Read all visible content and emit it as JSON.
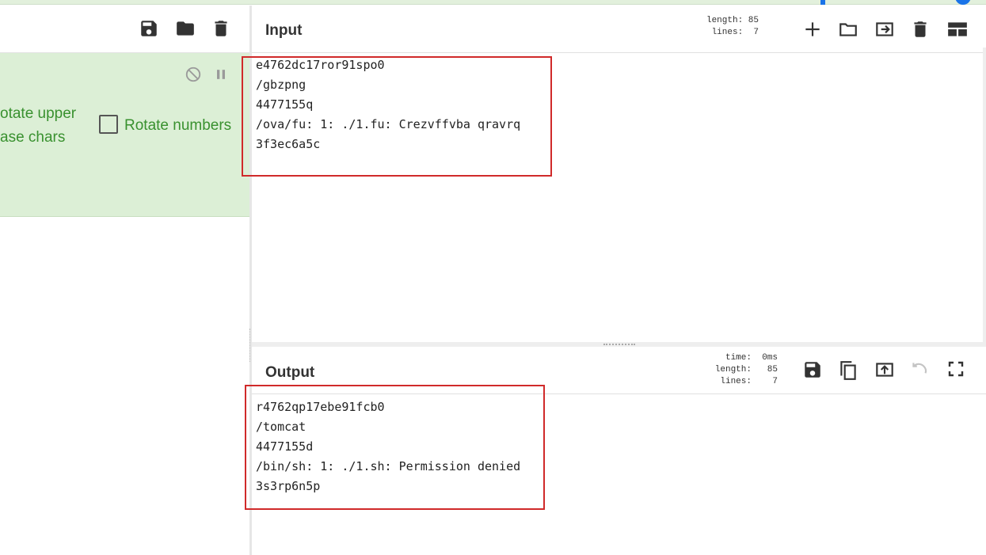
{
  "icons": {
    "left_toolbar": [
      "save-icon",
      "folder-icon",
      "trash-icon"
    ],
    "operation": [
      "disable-icon",
      "pause-icon"
    ],
    "input_toolbar": [
      "plus-icon",
      "open-folder-icon",
      "insert-icon",
      "trash-icon",
      "layout-icon"
    ],
    "output_toolbar": [
      "save-icon",
      "copy-icon",
      "replace-input-icon",
      "undo-icon",
      "maximize-icon"
    ]
  },
  "operation": {
    "rotate_upper_label_line1": "otate upper",
    "rotate_upper_label_line2": "ase chars",
    "rotate_numbers_label": "Rotate numbers",
    "rotate_numbers_checked": false
  },
  "input": {
    "title": "Input",
    "length_label": "length:",
    "length_value": "85",
    "lines_label": "lines:",
    "lines_value": "7",
    "lines": [
      "e4762dc17ror91spo0",
      "/gbzpng",
      "4477155q",
      "/ova/fu: 1: ./1.fu: Crezvffvba qravrq",
      "3f3ec6a5c"
    ]
  },
  "output": {
    "title": "Output",
    "time_label": "time:",
    "time_value": "0ms",
    "length_label": "length:",
    "length_value": "85",
    "lines_label": "lines:",
    "lines_value": "7",
    "lines": [
      "r4762qp17ebe91fcb0",
      "/tomcat",
      "4477155d",
      "/bin/sh: 1: ./1.sh: Permission denied",
      "3s3rp6n5p"
    ]
  },
  "colors": {
    "operation_bg": "#dcefd6",
    "operation_text": "#39912f",
    "highlight_box": "#d02a2a"
  }
}
